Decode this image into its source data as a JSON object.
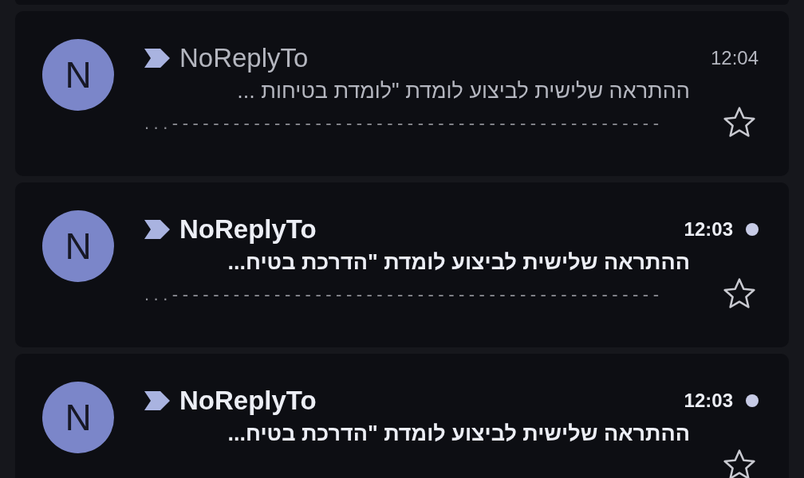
{
  "messages": [
    {
      "initial": "N",
      "sender": "NoReplyTo",
      "time": "12:04",
      "unread": false,
      "starred": false,
      "subject": "ההתראה שלישית לביצוע לומדת \"לומדת בטיחות ...",
      "snippet": "------------------------------------------------..."
    },
    {
      "initial": "N",
      "sender": "NoReplyTo",
      "time": "12:03",
      "unread": true,
      "starred": false,
      "subject": "ההתראה שלישית לביצוע לומדת \"הדרכת בטיח...",
      "snippet": "------------------------------------------------..."
    },
    {
      "initial": "N",
      "sender": "NoReplyTo",
      "time": "12:03",
      "unread": true,
      "starred": false,
      "subject": "ההתראה שלישית לביצוע לומדת \"הדרכת בטיח..."
    }
  ]
}
